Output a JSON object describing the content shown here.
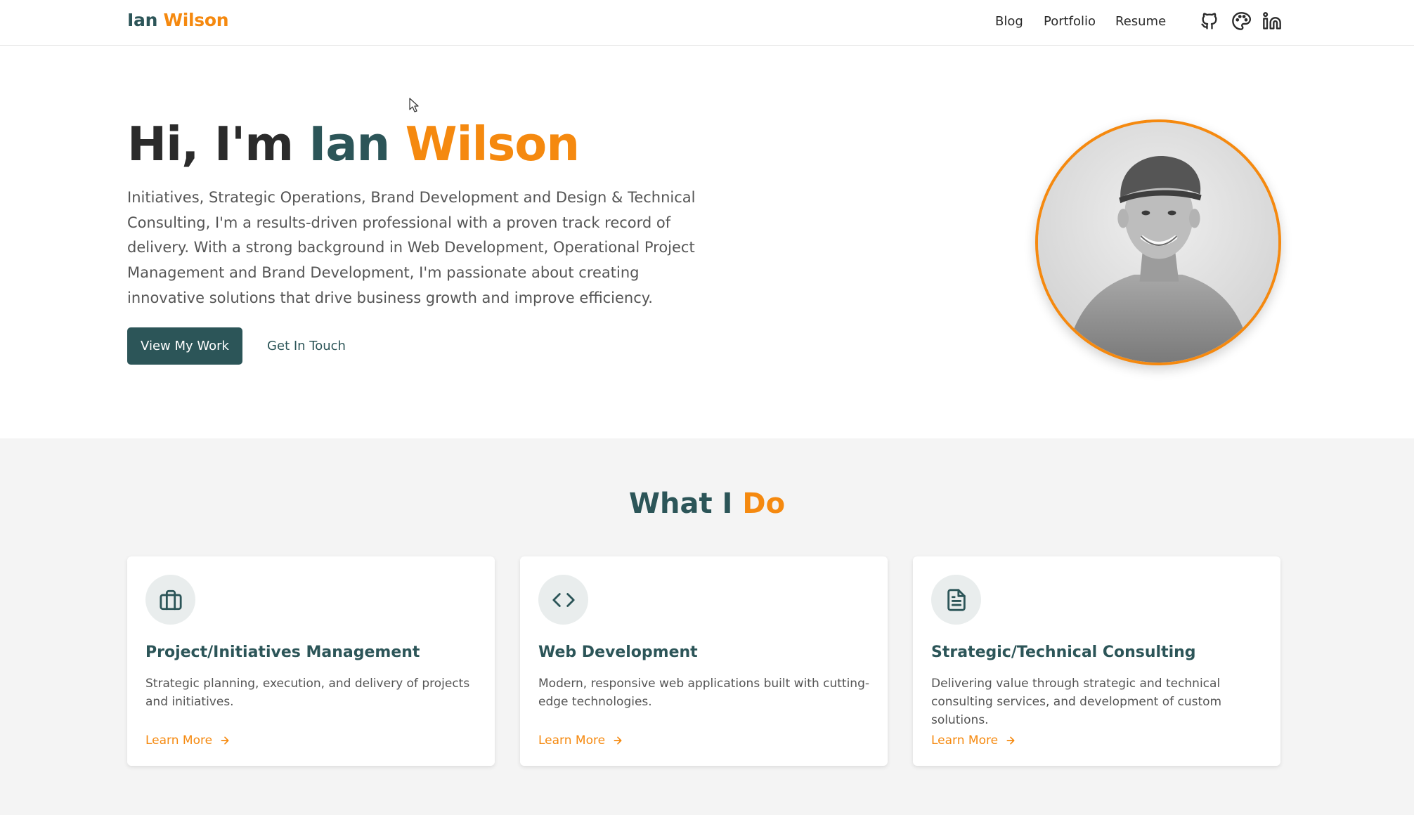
{
  "header": {
    "brand_first": "Ian",
    "brand_last": "Wilson",
    "nav": {
      "blog": "Blog",
      "portfolio": "Portfolio",
      "resume": "Resume"
    },
    "icons": [
      "github-icon",
      "palette-icon",
      "linkedin-icon"
    ]
  },
  "hero": {
    "title_prefix": "Hi, I'm",
    "title_first": "Ian",
    "title_last": "Wilson",
    "description": "Initiatives, Strategic Operations, Brand Development and Design & Technical Consulting, I'm a results-driven professional with a proven track record of delivery. With a strong background in Web Development, Operational Project Management and Brand Development, I'm passionate about creating innovative solutions that drive business growth and improve efficiency.",
    "primary_button": "View My Work",
    "secondary_button": "Get In Touch"
  },
  "services": {
    "title_first": "What I",
    "title_last": "Do",
    "cards": [
      {
        "icon": "briefcase-icon",
        "title": "Project/Initiatives Management",
        "description": "Strategic planning, execution, and delivery of projects and initiatives.",
        "link": "Learn More"
      },
      {
        "icon": "code-icon",
        "title": "Web Development",
        "description": "Modern, responsive web applications built with cutting-edge technologies.",
        "link": "Learn More"
      },
      {
        "icon": "document-icon",
        "title": "Strategic/Technical Consulting",
        "description": "Delivering value through strategic and technical consulting services, and development of custom solutions.",
        "link": "Learn More"
      }
    ]
  },
  "colors": {
    "teal": "#2c5558",
    "orange": "#f5890f",
    "section_bg": "#f4f4f4"
  }
}
